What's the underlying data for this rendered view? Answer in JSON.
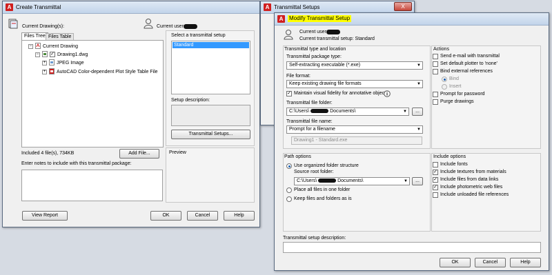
{
  "colors": {
    "title_highlight": "#ffff00",
    "selection": "#3399ff",
    "error_red": "#d01f1f"
  },
  "create": {
    "title": "Create Transmittal",
    "current_drawings_label": "Current Drawing(s):",
    "current_user_label": "Current user:",
    "tabs": [
      "Files Tree",
      "Files Table"
    ],
    "tree": {
      "root": "Current Drawing",
      "drawing": "Drawing1.dwg",
      "children": [
        "JPEG Image",
        "AutoCAD Color-dependent Plot Style Table File"
      ]
    },
    "included_files": "Included 4 file(s), 734KB",
    "add_file_button": "Add File...",
    "notes_label": "Enter notes to include with this transmittal package:",
    "select_setup_label": "Select a transmittal setup",
    "setups": [
      "Standard"
    ],
    "setup_description_label": "Setup description:",
    "transmittal_setups_button": "Transmittal Setups...",
    "preview_label": "Preview",
    "view_report_button": "View Report",
    "ok_button": "OK",
    "cancel_button": "Cancel",
    "help_button": "Help"
  },
  "setups_window": {
    "title": "Transmittal Setups",
    "close_label": "X"
  },
  "modify": {
    "title": "Modify Transmittal Setup",
    "current_user_label": "Current user:",
    "current_setup": "Current transmittal setup: Standard",
    "type_location_label": "Transmittal type and location",
    "package_type_label": "Transmittal package type:",
    "package_type_value": "Self-extracting executable (*.exe)",
    "file_format_label": "File format:",
    "file_format_value": "Keep existing drawing file formats",
    "maintain_fidelity_label": "Maintain visual fidelity for annotative objects",
    "file_folder_label": "Transmittal file folder:",
    "file_folder_prefix": "C:\\Users\\",
    "file_folder_suffix": "Documents\\",
    "browse_label": "...",
    "file_name_label": "Transmittal file name:",
    "file_name_value": "Prompt for a filename",
    "file_name_preview": "Drawing1 - Standard.exe",
    "actions_label": "Actions",
    "actions": [
      "Send e-mail with transmittal",
      "Set default plotter to 'none'",
      "Bind external references",
      "Bind",
      "Insert",
      "Prompt for password",
      "Purge drawings"
    ],
    "path_options_label": "Path options",
    "use_organized_label": "Use organized folder structure",
    "source_root_label": "Source root folder:",
    "source_root_prefix": "C:\\Users\\",
    "source_root_suffix": "Documents\\",
    "place_all_label": "Place all files in one folder",
    "keep_files_label": "Keep files and folders as is",
    "include_options_label": "Include options",
    "include_options": [
      "Include fonts",
      "Include textures from materials",
      "Include files from data links",
      "Include photometric web files",
      "Include unloaded file references"
    ],
    "setup_description_label": "Transmittal setup description:",
    "ok_button": "OK",
    "cancel_button": "Cancel",
    "help_button": "Help"
  }
}
